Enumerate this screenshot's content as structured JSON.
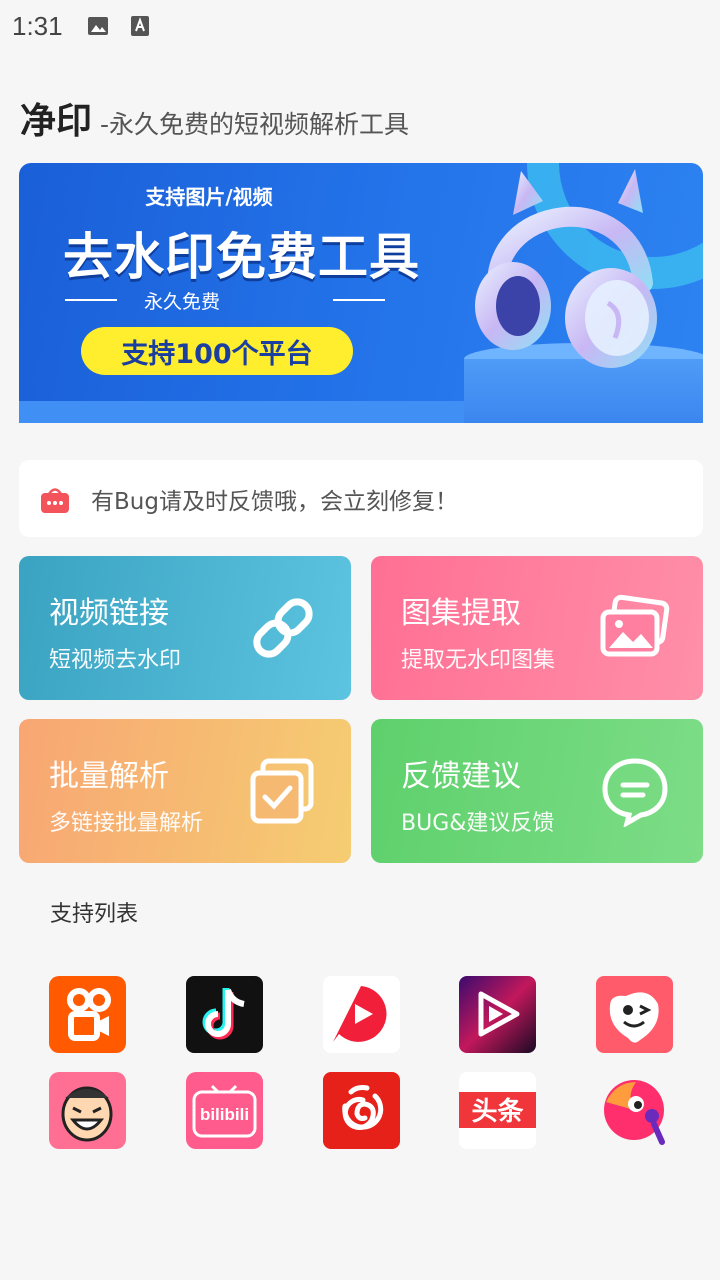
{
  "status_bar": {
    "time": "1:31",
    "icons": [
      "image-icon",
      "keyboard-a-icon"
    ]
  },
  "header": {
    "title": "净印",
    "subtitle": "-永久免费的短视频解析工具"
  },
  "banner": {
    "support_text": "支持图片/视频",
    "title": "去水印免费工具",
    "free_text": "永久免费",
    "pill_text": "支持100个平台",
    "colors": {
      "background": "#2474ea",
      "pill": "#ffee2e"
    }
  },
  "notice": {
    "icon": "shop-bag-icon",
    "text": "有Bug请及时反馈哦，会立刻修复！"
  },
  "cards": [
    {
      "title": "视频链接",
      "subtitle": "短视频去水印",
      "icon": "link-icon",
      "color": "#3aa3c1"
    },
    {
      "title": "图集提取",
      "subtitle": "提取无水印图集",
      "icon": "images-icon",
      "color": "#ff6f94"
    },
    {
      "title": "批量解析",
      "subtitle": "多链接批量解析",
      "icon": "check-copy-icon",
      "color": "#f8a673"
    },
    {
      "title": "反馈建议",
      "subtitle": "BUG&建议反馈",
      "icon": "chat-icon",
      "color": "#5ed06c"
    }
  ],
  "support_list": {
    "title": "支持列表",
    "platforms": [
      {
        "icon": "kuaishou-logo-icon",
        "color": "#ff5a00"
      },
      {
        "icon": "douyin-logo-icon",
        "color": "#111111"
      },
      {
        "icon": "weishi-logo-icon",
        "color": "#f21f3b"
      },
      {
        "icon": "video-play-logo-icon",
        "color": "#1a0a25"
      },
      {
        "icon": "pipixia-logo-icon",
        "color": "#ff5b6b"
      },
      {
        "icon": "laughing-face-logo-icon",
        "color": "#ff6f94"
      },
      {
        "icon": "bilibili-logo-icon",
        "color": "#ff5c8d"
      },
      {
        "icon": "netease-music-logo-icon",
        "color": "#e6211a"
      },
      {
        "icon": "toutiao-logo-icon",
        "color": "#f0353b"
      },
      {
        "icon": "zuiyou-logo-icon",
        "color": "#ff2e6d"
      }
    ],
    "toutiao_text": "头条",
    "bilibili_text": "bilibili"
  }
}
